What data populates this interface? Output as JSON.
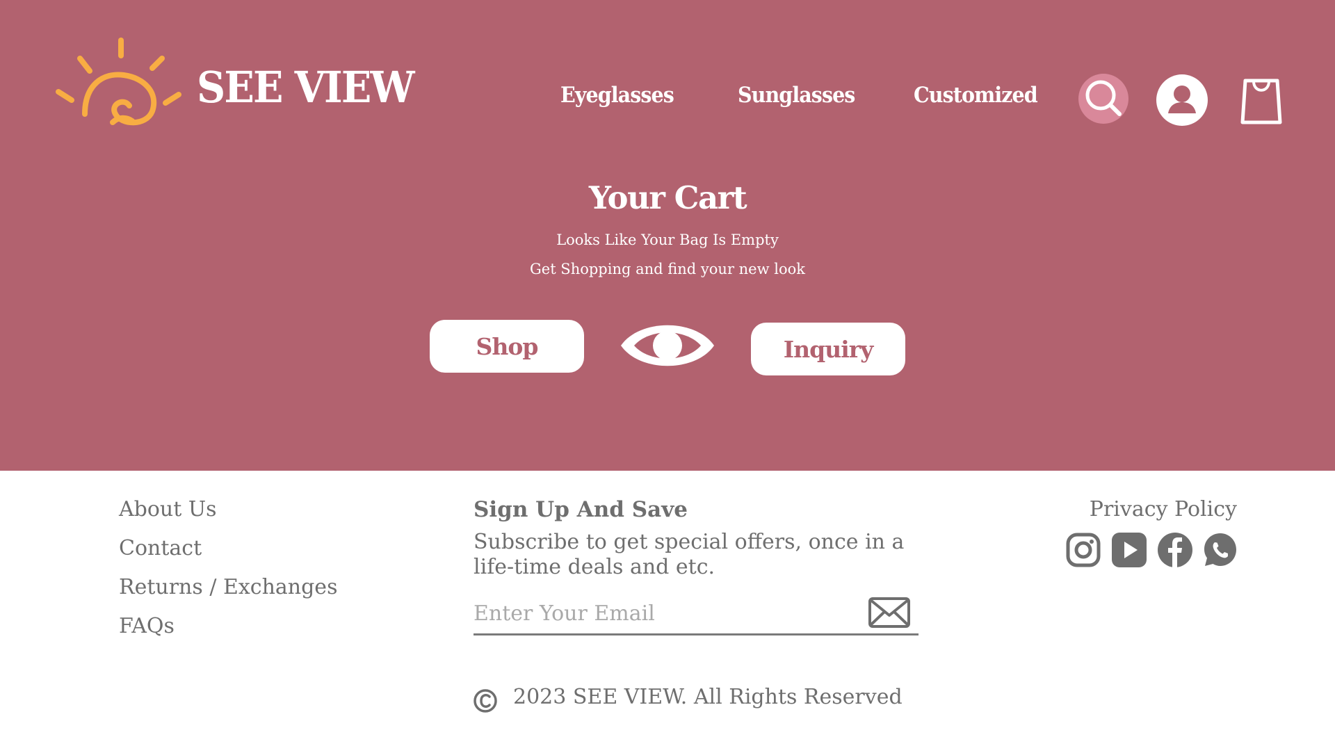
{
  "brand": {
    "name": "SEE VIEW",
    "logo_icon": "sun-eye-logo"
  },
  "nav": {
    "items": [
      {
        "label": "Eyeglasses"
      },
      {
        "label": "Sunglasses"
      },
      {
        "label": "Customized"
      }
    ],
    "icons": [
      "search-icon",
      "account-icon",
      "shopping-bag-icon"
    ]
  },
  "cart": {
    "title": "Your Cart",
    "empty_message": "Looks Like Your Bag Is Empty",
    "prompt": "Get Shopping and find your new look",
    "shop_label": "Shop",
    "inquiry_label": "Inquiry"
  },
  "footer": {
    "links": [
      "About Us",
      "Contact",
      "Returns / Exchanges",
      "FAQs"
    ],
    "signup": {
      "title": "Sign Up And Save",
      "description": "Subscribe to get special offers, once in a life-time deals and etc.",
      "email_placeholder": "Enter Your Email"
    },
    "privacy_label": "Privacy Policy",
    "social_icons": [
      "instagram-icon",
      "youtube-icon",
      "facebook-icon",
      "whatsapp-icon"
    ],
    "copyright": "2023 SEE VIEW. All Rights Reserved"
  },
  "colors": {
    "hero_background": "#b2626f",
    "logo_orange": "#f8ad43",
    "search_highlight": "#d9889a",
    "footer_text": "#6e6e6e"
  }
}
